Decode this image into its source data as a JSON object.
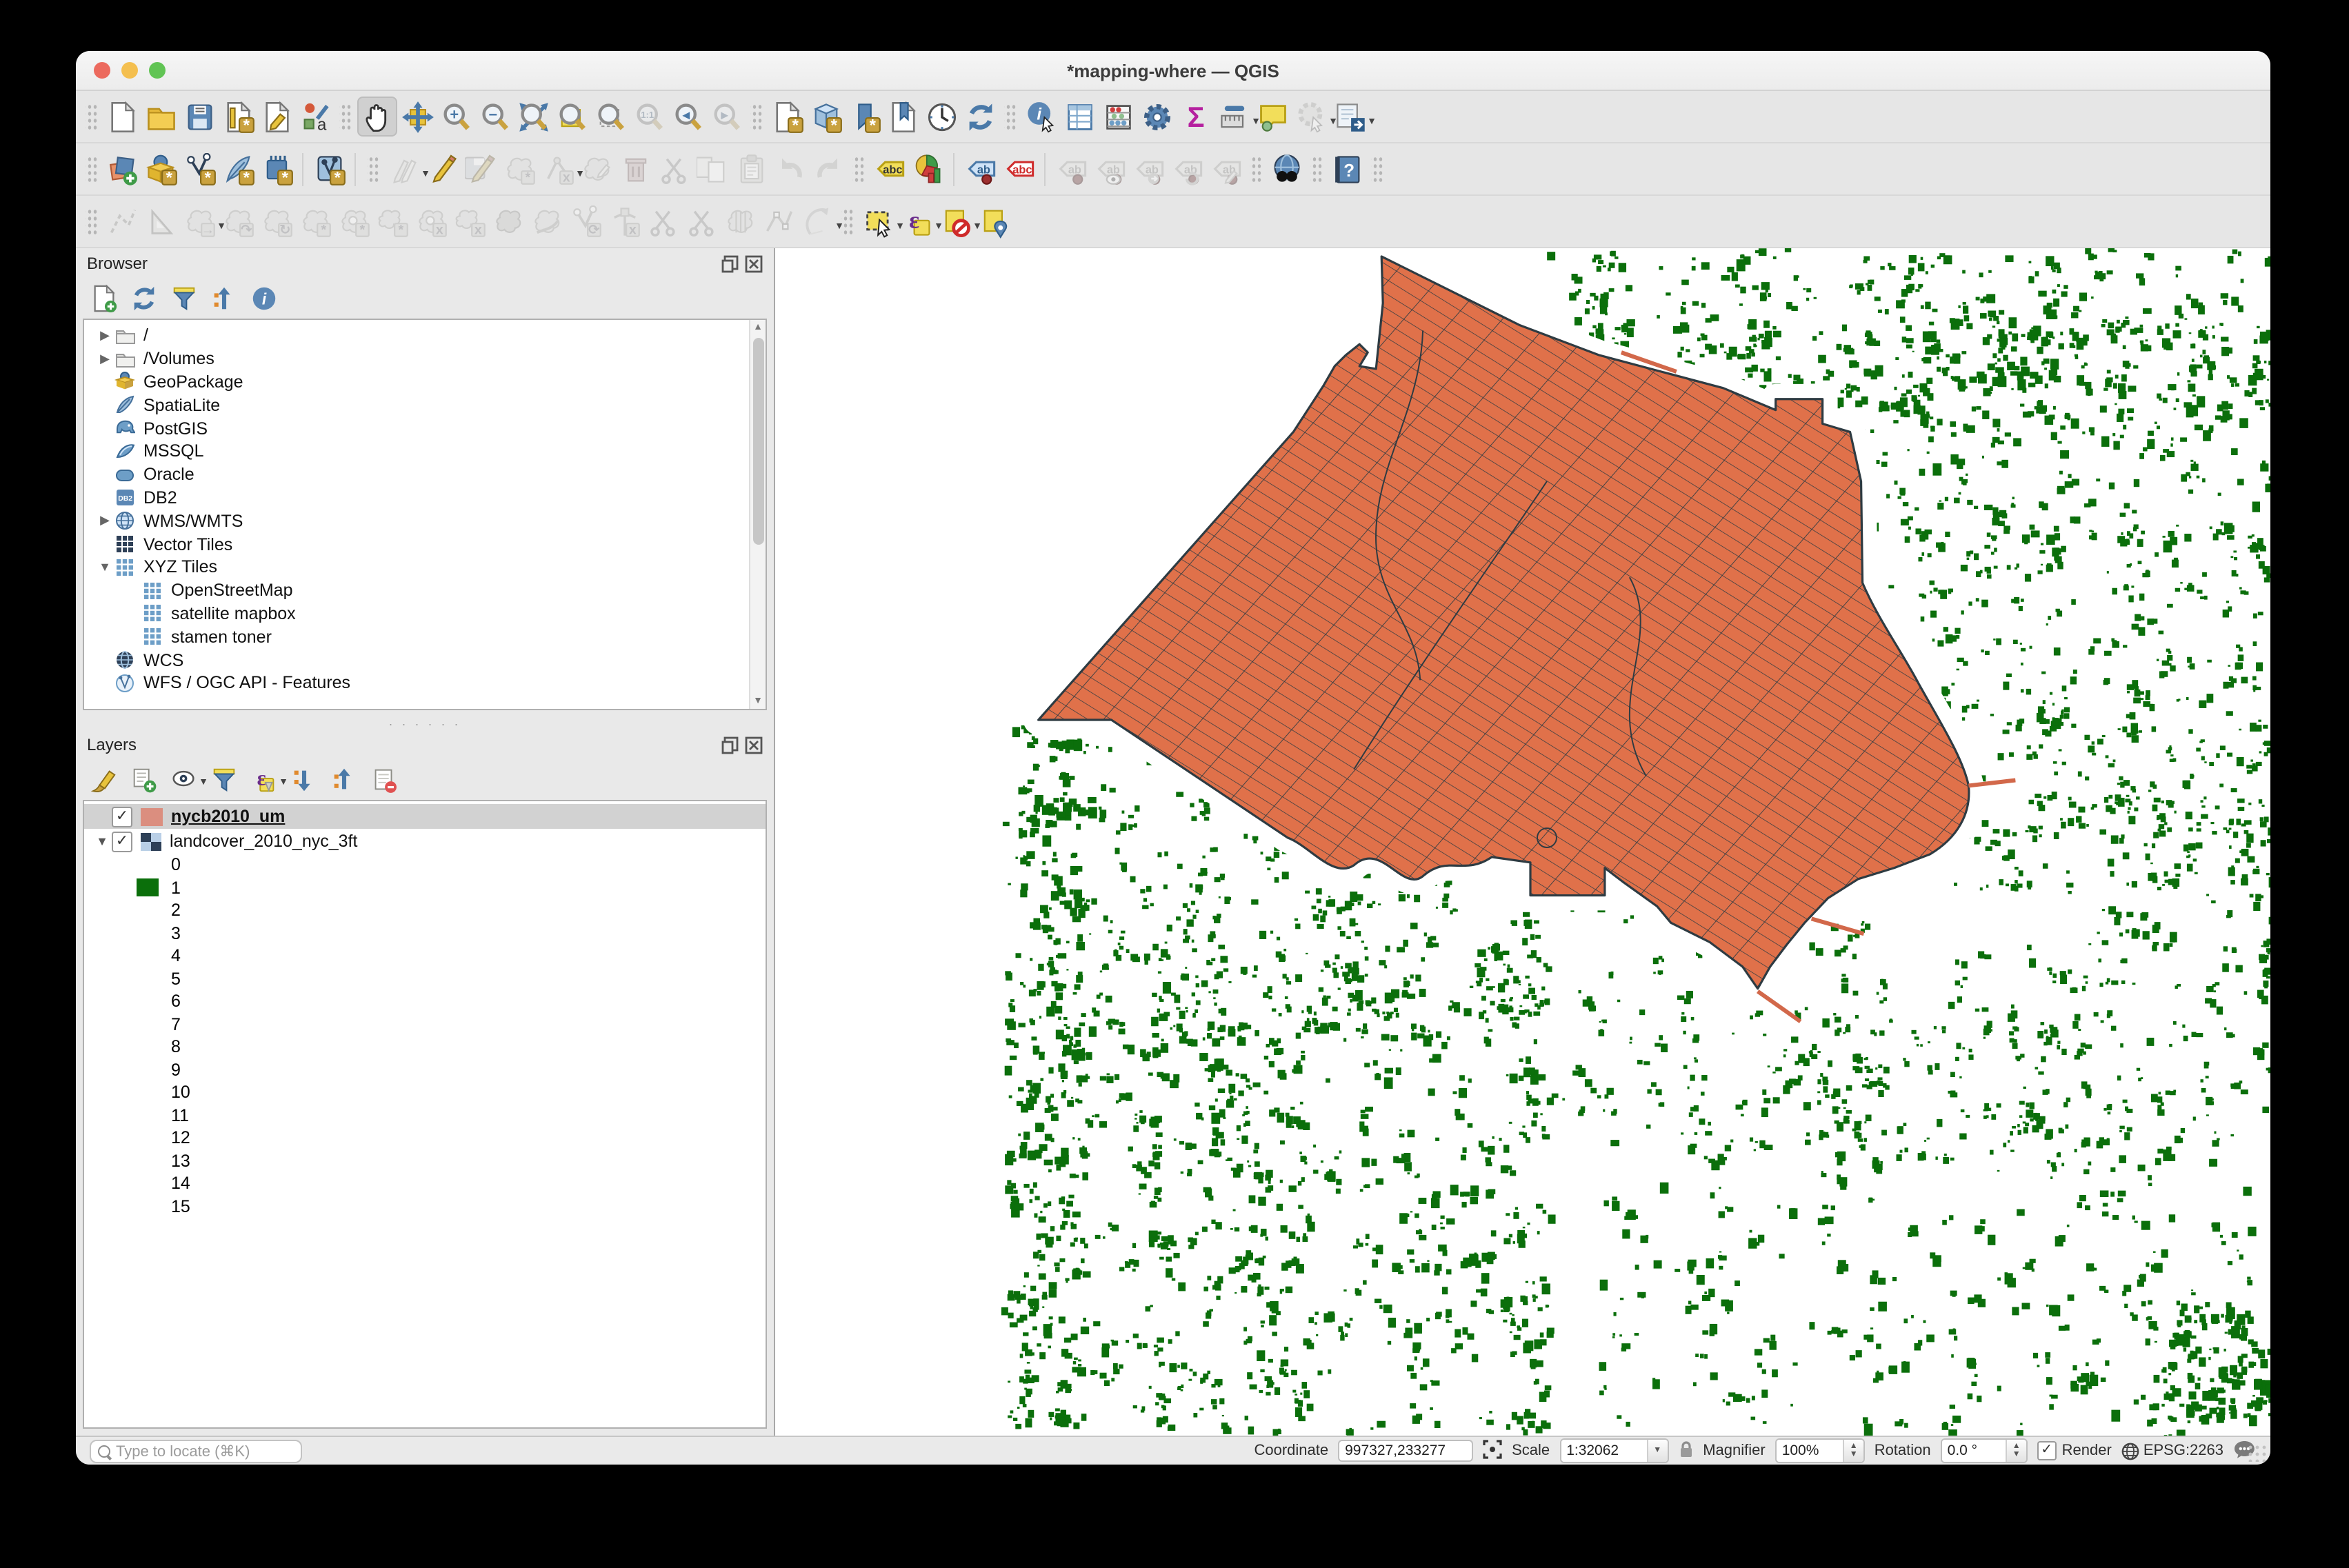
{
  "window": {
    "title": "*mapping-where — QGIS"
  },
  "map": {
    "colors": {
      "blocks_fill": "#e0714a",
      "blocks_outline": "#2e3b42",
      "landcover_green": "#0b6f0b",
      "background": "#ffffff"
    }
  },
  "toolbars": {
    "rows": [
      [
        {
          "g": 1
        },
        {
          "n": "new-project-button",
          "k": "page"
        },
        {
          "n": "open-project-button",
          "k": "folder"
        },
        {
          "n": "save-project-button",
          "k": "floppy"
        },
        {
          "n": "new-print-layout-button",
          "k": "layoutpage"
        },
        {
          "n": "show-layout-manager-button",
          "k": "layoutmgr"
        },
        {
          "n": "style-manager-button",
          "k": "stylekit"
        },
        {
          "g": 1
        },
        {
          "n": "pan-map-tool",
          "k": "hand",
          "a": 1
        },
        {
          "n": "pan-to-selection-tool",
          "k": "pansel"
        },
        {
          "n": "zoom-in-tool",
          "k": "mag",
          "t": "+"
        },
        {
          "n": "zoom-out-tool",
          "k": "mag",
          "t": "−"
        },
        {
          "n": "zoom-full-tool",
          "k": "magfull"
        },
        {
          "n": "zoom-to-layer-tool",
          "k": "maglayer"
        },
        {
          "n": "zoom-to-selection-tool",
          "k": "magsel"
        },
        {
          "n": "zoom-native-tool",
          "k": "mag",
          "t": "1:1",
          "d": 1
        },
        {
          "n": "zoom-last-tool",
          "k": "mag",
          "t": "◂"
        },
        {
          "n": "zoom-next-tool",
          "k": "mag",
          "t": "▸",
          "d": 1
        },
        {
          "g": 1
        },
        {
          "n": "new-map-view-button",
          "k": "pagegear"
        },
        {
          "n": "new-3d-map-view-button",
          "k": "cube"
        },
        {
          "n": "new-spatial-bookmark-button",
          "k": "bookmark"
        },
        {
          "n": "show-spatial-bookmarks-button",
          "k": "bookpage"
        },
        {
          "n": "temporal-controller-button",
          "k": "clock"
        },
        {
          "n": "refresh-map-button",
          "k": "refresh"
        },
        {
          "g": 1
        },
        {
          "n": "identify-features-tool",
          "k": "info"
        },
        {
          "n": "open-attribute-table-button",
          "k": "table"
        },
        {
          "n": "statistical-summary-button",
          "k": "abacus"
        },
        {
          "n": "processing-toolbox-button",
          "k": "gear"
        },
        {
          "n": "show-statistics-button",
          "k": "sigma"
        },
        {
          "n": "measure-tool",
          "k": "ruler",
          "dd": 1
        },
        {
          "n": "map-tips-button",
          "k": "bubble"
        },
        {
          "n": "run-feature-action-button",
          "k": "actiongear",
          "d": 1,
          "dd": 1
        },
        {
          "n": "select-features-dialog-button",
          "k": "dialogarrow",
          "dd": 1
        }
      ],
      [
        {
          "g": 1
        },
        {
          "n": "data-source-manager-button",
          "k": "layersplus"
        },
        {
          "n": "add-vector-layer-button",
          "k": "boxglobe"
        },
        {
          "n": "add-delimited-text-layer-button",
          "k": "vnodes"
        },
        {
          "n": "add-spatialite-layer-button",
          "k": "feather"
        },
        {
          "n": "add-mesh-layer-button",
          "k": "chip"
        },
        {
          "s": 1
        },
        {
          "n": "add-virtual-layer-button",
          "k": "vbox"
        },
        {
          "s": 1
        },
        {
          "g": 1
        },
        {
          "n": "current-edits-button",
          "k": "pencils",
          "d": 1,
          "dd": 1
        },
        {
          "n": "toggle-editing-button",
          "k": "pencil"
        },
        {
          "n": "save-layer-edits-button",
          "k": "floppypencil",
          "d": 1
        },
        {
          "n": "digitize-with-shape-button",
          "k": "blob",
          "t": "*",
          "d": 1
        },
        {
          "n": "advanced-digitize-button",
          "k": "digi",
          "d": 1,
          "dd": 1
        },
        {
          "n": "modify-attributes-button",
          "k": "multiedit",
          "d": 1
        },
        {
          "n": "delete-selected-button",
          "k": "trash",
          "d": 1
        },
        {
          "n": "cut-features-button",
          "k": "scissors",
          "d": 1
        },
        {
          "n": "copy-features-button",
          "k": "copy",
          "d": 1
        },
        {
          "n": "paste-features-button",
          "k": "paste",
          "d": 1
        },
        {
          "n": "undo-button",
          "k": "undo",
          "d": 1
        },
        {
          "n": "redo-button",
          "k": "redo",
          "d": 1
        },
        {
          "g": 1
        },
        {
          "n": "layer-labeling-button",
          "k": "abc",
          "c": "yellow"
        },
        {
          "n": "layer-diagram-button",
          "k": "pie"
        },
        {
          "s": 1
        },
        {
          "n": "pin-labels-button",
          "k": "abc",
          "c": "blue"
        },
        {
          "n": "highlight-pinned-labels-button",
          "k": "abc",
          "c": "red"
        },
        {
          "s": 1
        },
        {
          "n": "move-label-button",
          "k": "abc",
          "c": "gray",
          "d": 1
        },
        {
          "n": "show-hide-labels-button",
          "k": "abceye",
          "d": 1
        },
        {
          "n": "move-label-diagram-button",
          "k": "abcarrow",
          "d": 1
        },
        {
          "n": "rotate-label-button",
          "k": "abcrotate",
          "d": 1
        },
        {
          "n": "change-label-button",
          "k": "abcedit",
          "d": 1
        },
        {
          "g": 1
        },
        {
          "n": "metasearch-button",
          "k": "binoc"
        },
        {
          "g": 1
        },
        {
          "n": "help-contents-button",
          "k": "help"
        },
        {
          "g": 1
        }
      ],
      [
        {
          "g": 1
        },
        {
          "n": "tracing-tool",
          "k": "dashline",
          "d": 1
        },
        {
          "n": "advanced-digitizing-panel-button",
          "k": "setsquare",
          "d": 1
        },
        {
          "n": "move-feature-tool",
          "k": "blob",
          "t": "→",
          "d": 1,
          "dd": 1
        },
        {
          "n": "copy-move-feature-tool",
          "k": "blob",
          "t": "↷",
          "d": 1
        },
        {
          "n": "rotate-feature-tool",
          "k": "blob",
          "t": "↻",
          "d": 1
        },
        {
          "n": "simplify-feature-tool",
          "k": "blob",
          "t": "*",
          "d": 1
        },
        {
          "n": "add-ring-tool",
          "k": "blobhole",
          "t": "*",
          "d": 1
        },
        {
          "n": "add-part-tool",
          "k": "blob2",
          "t": "*",
          "d": 1
        },
        {
          "n": "fill-ring-tool",
          "k": "blobhole",
          "t": "x",
          "d": 1
        },
        {
          "n": "delete-ring-tool",
          "k": "blob2",
          "t": "x",
          "d": 1
        },
        {
          "n": "delete-part-tool",
          "k": "blobdark",
          "d": 1
        },
        {
          "n": "offset-curve-tool",
          "k": "blobcurve",
          "d": 1
        },
        {
          "n": "reshape-features-tool",
          "k": "vnodesgray",
          "d": 1
        },
        {
          "n": "split-parts-tool",
          "k": "splitpin",
          "d": 1
        },
        {
          "n": "split-features-tool",
          "k": "scissorsblob",
          "d": 1
        },
        {
          "n": "merge-features-tool",
          "k": "scissorsblob",
          "d": 1
        },
        {
          "n": "merge-attributes-tool",
          "k": "blobzip",
          "d": 1
        },
        {
          "n": "vertex-tool",
          "k": "vertextool",
          "d": 1
        },
        {
          "n": "rotate-point-symbols-tool",
          "k": "curverot",
          "d": 1,
          "dd": 1
        },
        {
          "g": 1
        },
        {
          "n": "select-features-tool",
          "k": "selectrect",
          "dd": 1
        },
        {
          "n": "select-by-expression-tool",
          "k": "epsilon",
          "dd": 1
        },
        {
          "n": "deselect-features-tool",
          "k": "noslash",
          "dd": 1
        },
        {
          "n": "select-by-location-tool",
          "k": "pinyellow"
        }
      ]
    ]
  },
  "browser": {
    "title": "Browser",
    "tools": [
      {
        "n": "browser-add-selected-layers-button",
        "k": "pageplus"
      },
      {
        "n": "browser-refresh-button",
        "k": "refresh"
      },
      {
        "n": "browser-filter-button",
        "k": "funnel"
      },
      {
        "n": "browser-collapse-all-button",
        "k": "collapsetree"
      },
      {
        "n": "browser-properties-button",
        "k": "infocircle"
      }
    ],
    "items": [
      {
        "label": "/",
        "icon": "tfolder",
        "exp": "c",
        "depth": 0
      },
      {
        "label": "/Volumes",
        "icon": "tfolder",
        "exp": "c",
        "depth": 0
      },
      {
        "label": "GeoPackage",
        "icon": "gpkg",
        "depth": 0
      },
      {
        "label": "SpatiaLite",
        "icon": "slite",
        "depth": 0
      },
      {
        "label": "PostGIS",
        "icon": "pgis",
        "depth": 0
      },
      {
        "label": "MSSQL",
        "icon": "mssql",
        "depth": 0
      },
      {
        "label": "Oracle",
        "icon": "oracle",
        "depth": 0
      },
      {
        "label": "DB2",
        "icon": "db2",
        "depth": 0
      },
      {
        "label": "WMS/WMTS",
        "icon": "wms",
        "exp": "c",
        "depth": 0
      },
      {
        "label": "Vector Tiles",
        "icon": "vtiles",
        "depth": 0
      },
      {
        "label": "XYZ Tiles",
        "icon": "xyz",
        "exp": "e",
        "depth": 0
      },
      {
        "label": "OpenStreetMap",
        "icon": "xyz",
        "depth": 1
      },
      {
        "label": "satellite mapbox",
        "icon": "xyz",
        "depth": 1
      },
      {
        "label": "stamen toner",
        "icon": "xyz",
        "depth": 1
      },
      {
        "label": "WCS",
        "icon": "wcs",
        "depth": 0
      },
      {
        "label": "WFS / OGC API - Features",
        "icon": "wfs",
        "depth": 0
      }
    ]
  },
  "layers": {
    "title": "Layers",
    "tools": [
      {
        "n": "open-layer-styling-button",
        "k": "brush"
      },
      {
        "n": "add-group-button",
        "k": "groupplus"
      },
      {
        "n": "manage-map-themes-button",
        "k": "eyedd",
        "dd": 1
      },
      {
        "n": "filter-legend-button",
        "k": "funnel"
      },
      {
        "n": "filter-by-expression-button",
        "k": "epsmall",
        "dd": 1
      },
      {
        "n": "expand-all-button",
        "k": "expandall"
      },
      {
        "n": "collapse-all-button",
        "k": "collapseall"
      },
      {
        "n": "remove-layer-button",
        "k": "removelayer"
      }
    ],
    "items": [
      {
        "type": "vector",
        "label": "nycb2010_um",
        "checked": true,
        "selected": true,
        "swatch": "#db8e7f"
      },
      {
        "type": "raster",
        "label": "landcover_2010_nyc_3ft",
        "checked": true,
        "expanded": true
      },
      {
        "type": "class",
        "label": "0"
      },
      {
        "type": "class",
        "label": "1",
        "swatch": "#0b6f0b"
      },
      {
        "type": "class",
        "label": "2"
      },
      {
        "type": "class",
        "label": "3"
      },
      {
        "type": "class",
        "label": "4"
      },
      {
        "type": "class",
        "label": "5"
      },
      {
        "type": "class",
        "label": "6"
      },
      {
        "type": "class",
        "label": "7"
      },
      {
        "type": "class",
        "label": "8"
      },
      {
        "type": "class",
        "label": "9"
      },
      {
        "type": "class",
        "label": "10"
      },
      {
        "type": "class",
        "label": "11"
      },
      {
        "type": "class",
        "label": "12"
      },
      {
        "type": "class",
        "label": "13"
      },
      {
        "type": "class",
        "label": "14"
      },
      {
        "type": "class",
        "label": "15"
      }
    ]
  },
  "statusbar": {
    "locator_placeholder": "Type to locate (⌘K)",
    "coordinate_label": "Coordinate",
    "coordinate_value": "997327,233277",
    "scale_label": "Scale",
    "scale_value": "1:32062",
    "magnifier_label": "Magnifier",
    "magnifier_value": "100%",
    "rotation_label": "Rotation",
    "rotation_value": "0.0 °",
    "render_label": "Render",
    "crs_label": "EPSG:2263"
  }
}
